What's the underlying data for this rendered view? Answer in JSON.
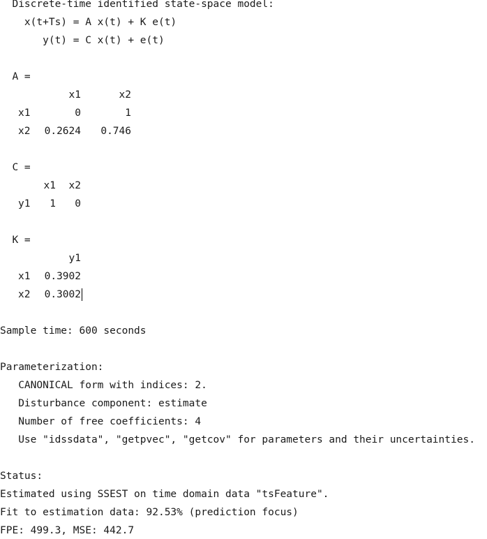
{
  "header": {
    "title": "  Discrete-time identified state-space model:",
    "eq1": "    x(t+Ts) = A x(t) + K e(t)",
    "eq2": "       y(t) = C x(t) + e(t)"
  },
  "matA": {
    "label": "  A =",
    "col1": "x1",
    "col2": "x2",
    "rows": [
      {
        "name": "x1",
        "v1": "0",
        "v2": "1"
      },
      {
        "name": "x2",
        "v1": "0.2624",
        "v2": "0.746"
      }
    ]
  },
  "matC": {
    "label": "  C =",
    "col1": "x1",
    "col2": "x2",
    "rows": [
      {
        "name": "y1",
        "v1": "1",
        "v2": "0"
      }
    ]
  },
  "matK": {
    "label": "  K =",
    "col1": "y1",
    "rows": [
      {
        "name": "x1",
        "v1": "0.3902"
      },
      {
        "name": "x2",
        "v1": "0.3002"
      }
    ]
  },
  "sample_time": "Sample time: 600 seconds",
  "param": {
    "heading": "Parameterization:",
    "line1": "   CANONICAL form with indices: 2.",
    "line2": "   Disturbance component: estimate",
    "line3": "   Number of free coefficients: 4",
    "line4": "   Use \"idssdata\", \"getpvec\", \"getcov\" for parameters and their uncertainties."
  },
  "status": {
    "heading": "Status:",
    "line1": "Estimated using SSEST on time domain data \"tsFeature\".",
    "line2": "Fit to estimation data: 92.53% (prediction focus)",
    "line3": "FPE: 499.3, MSE: 442.7"
  }
}
